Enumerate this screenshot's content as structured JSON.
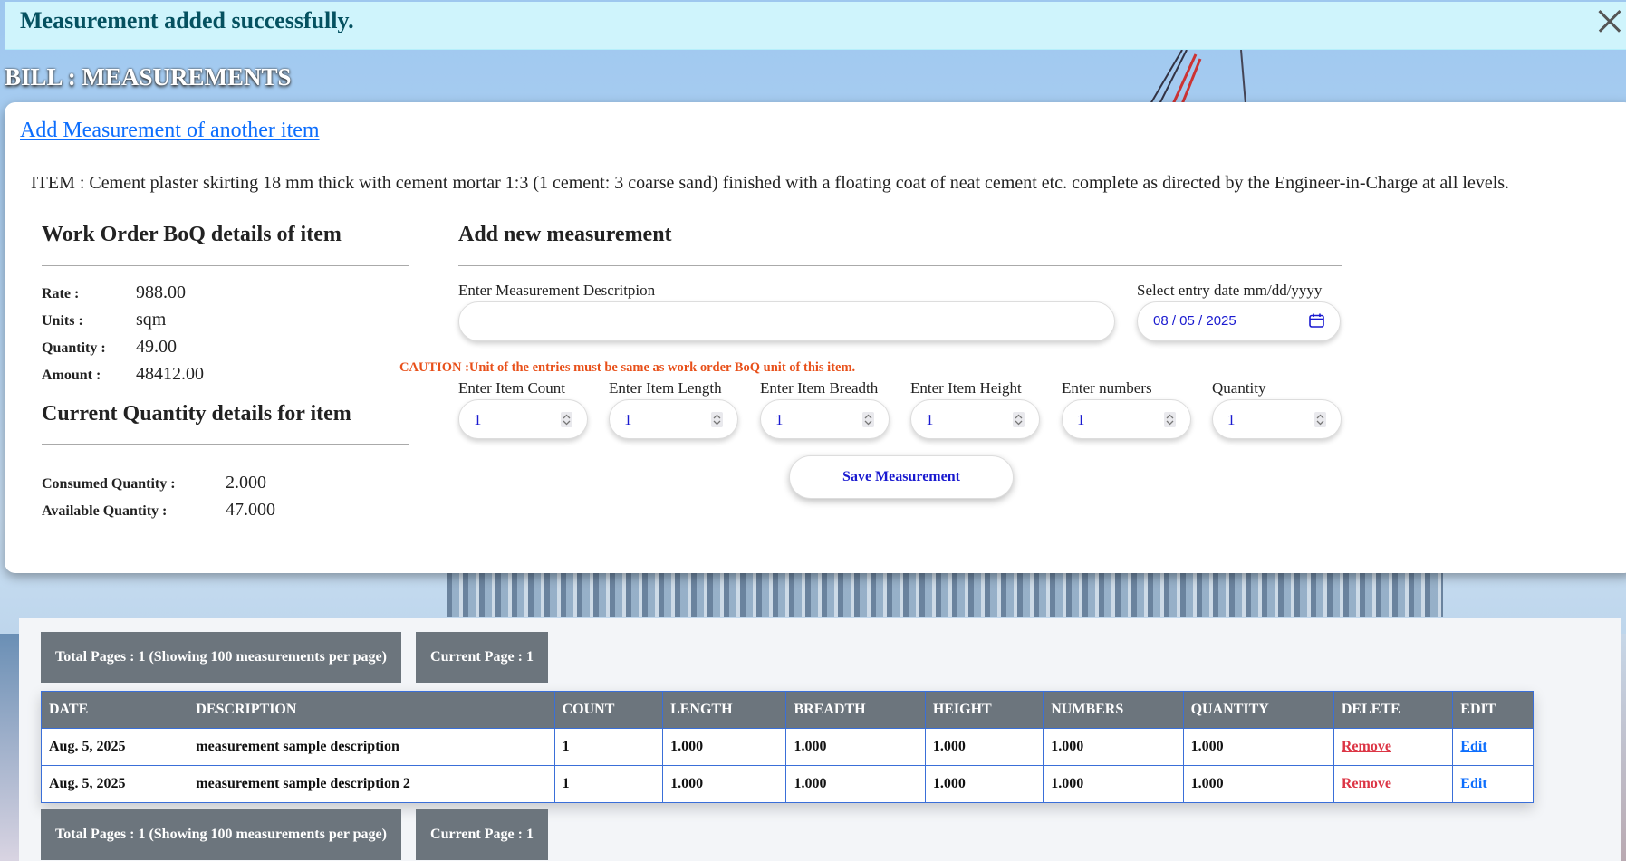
{
  "alert": {
    "message": "Measurement added successfully."
  },
  "page": {
    "heading": "BILL : MEASUREMENTS"
  },
  "card": {
    "add_link": "Add Measurement of another item",
    "item_description": "ITEM : Cement plaster skirting 18 mm thick with cement mortar 1:3 (1 cement: 3 coarse sand) finished with a floating coat of neat cement etc. complete as directed by the Engineer-in-Charge at all levels."
  },
  "boq": {
    "title": "Work Order BoQ details of item",
    "rows": [
      {
        "label": "Rate :",
        "value": "988.00"
      },
      {
        "label": "Units :",
        "value": "sqm"
      },
      {
        "label": "Quantity :",
        "value": "49.00"
      },
      {
        "label": "Amount :",
        "value": "48412.00"
      }
    ]
  },
  "current": {
    "title": "Current Quantity details for item",
    "rows": [
      {
        "label": "Consumed Quantity :",
        "value": "2.000"
      },
      {
        "label": "Available Quantity :",
        "value": "47.000"
      }
    ]
  },
  "form": {
    "title": "Add new measurement",
    "description_label": "Enter Measurement Descritpion",
    "description_value": "",
    "date_label": "Select entry date mm/dd/yyyy",
    "date_value": "08 / 05 / 2025",
    "caution": "CAUTION :Unit of the entries must be same as work order BoQ unit of this item.",
    "fields": [
      {
        "label": "Enter Item Count",
        "value": "1"
      },
      {
        "label": "Enter Item Length",
        "value": "1"
      },
      {
        "label": "Enter Item Breadth",
        "value": "1"
      },
      {
        "label": "Enter Item Height",
        "value": "1"
      },
      {
        "label": "Enter numbers",
        "value": "1"
      },
      {
        "label": "Quantity",
        "value": "1"
      }
    ],
    "save_label": "Save Measurement"
  },
  "pager": {
    "total_pages": "Total Pages : 1 (Showing 100 measurements per page)",
    "current_page": "Current Page : 1"
  },
  "table": {
    "headers": [
      "DATE",
      "DESCRIPTION",
      "COUNT",
      "LENGTH",
      "BREADTH",
      "HEIGHT",
      "NUMBERS",
      "QUANTITY",
      "DELETE",
      "EDIT"
    ],
    "rows": [
      {
        "date": "Aug. 5, 2025",
        "description": "measurement sample description",
        "count": "1",
        "length": "1.000",
        "breadth": "1.000",
        "height": "1.000",
        "numbers": "1.000",
        "quantity": "1.000",
        "delete": "Remove",
        "edit": "Edit"
      },
      {
        "date": "Aug. 5, 2025",
        "description": "measurement sample description 2",
        "count": "1",
        "length": "1.000",
        "breadth": "1.000",
        "height": "1.000",
        "numbers": "1.000",
        "quantity": "1.000",
        "delete": "Remove",
        "edit": "Edit"
      }
    ]
  }
}
